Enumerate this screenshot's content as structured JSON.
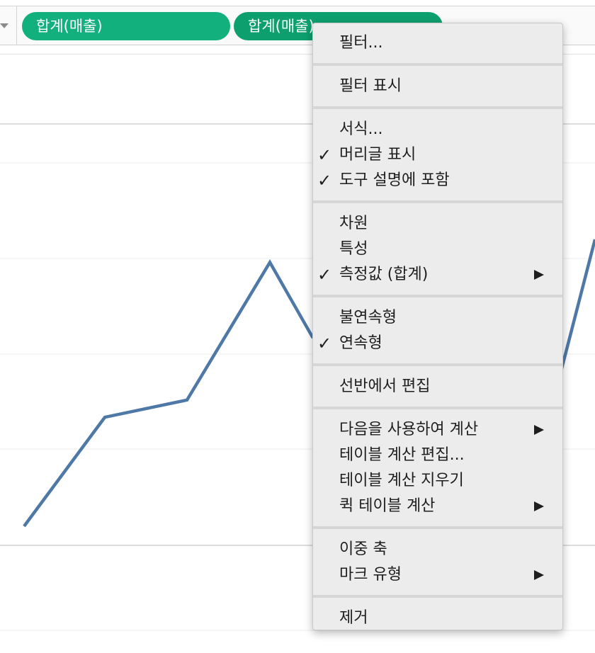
{
  "shelf": {
    "pills": [
      {
        "label": "합계(매출)"
      },
      {
        "label": "합계(매출)"
      }
    ]
  },
  "chart_data": {
    "type": "line",
    "series": [
      {
        "values": [
          20,
          39,
          42,
          66,
          53,
          39,
          47,
          70
        ]
      }
    ],
    "ylim": [
      0,
      100
    ],
    "grid": true,
    "color": "#4e79a7"
  },
  "context_menu": {
    "groups": [
      [
        {
          "label": "필터..."
        }
      ],
      [
        {
          "label": "필터 표시"
        }
      ],
      [
        {
          "label": "서식..."
        },
        {
          "label": "머리글 표시",
          "checked": true
        },
        {
          "label": "도구 설명에 포함",
          "checked": true
        }
      ],
      [
        {
          "label": "차원"
        },
        {
          "label": "특성"
        },
        {
          "label": "측정값 (합계)",
          "checked": true,
          "submenu": true
        }
      ],
      [
        {
          "label": "불연속형"
        },
        {
          "label": "연속형",
          "checked": true
        }
      ],
      [
        {
          "label": "선반에서 편집"
        }
      ],
      [
        {
          "label": "다음을 사용하여 계산",
          "submenu": true
        },
        {
          "label": "테이블 계산 편집..."
        },
        {
          "label": "테이블 계산 지우기"
        },
        {
          "label": "퀵 테이블 계산",
          "submenu": true
        }
      ],
      [
        {
          "label": "이중 축"
        },
        {
          "label": "마크 유형",
          "submenu": true
        }
      ],
      [
        {
          "label": "제거"
        }
      ]
    ],
    "check_mark": "✓"
  }
}
